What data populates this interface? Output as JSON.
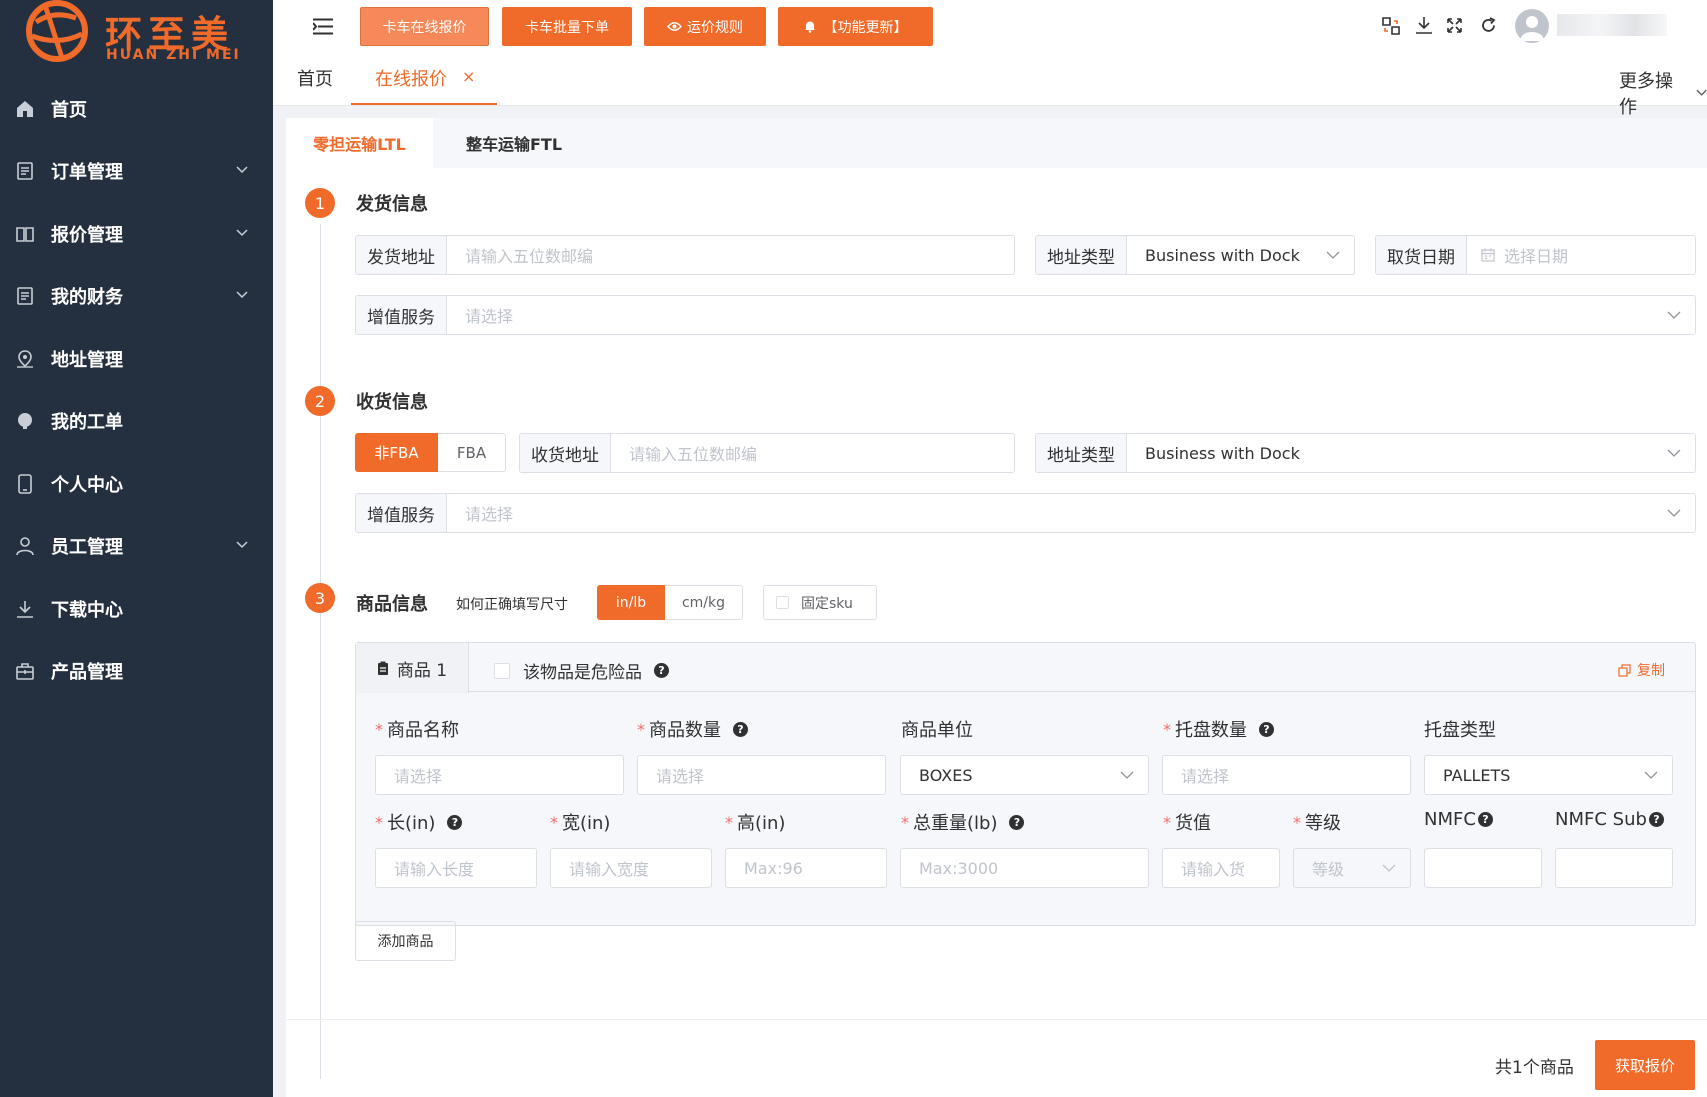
{
  "brand": {
    "name": "环至美",
    "subtitle": "HUAN ZHI MEI",
    "accent": "#f06a2a",
    "sidebar_bg": "#24303f"
  },
  "sidebar": {
    "items": [
      {
        "label": "首页",
        "icon": "home-icon"
      },
      {
        "label": "订单管理",
        "icon": "order-icon"
      },
      {
        "label": "报价管理",
        "icon": "book-icon"
      },
      {
        "label": "我的财务",
        "icon": "finance-icon"
      },
      {
        "label": "地址管理",
        "icon": "location-icon"
      },
      {
        "label": "我的工单",
        "icon": "ticket-icon"
      },
      {
        "label": "个人中心",
        "icon": "tablet-icon"
      },
      {
        "label": "员工管理",
        "icon": "user-icon"
      },
      {
        "label": "下载中心",
        "icon": "download-icon"
      },
      {
        "label": "产品管理",
        "icon": "bag-icon"
      }
    ]
  },
  "toolbar": {
    "btn_online_quote": "卡车在线报价",
    "btn_batch_order": "卡车批量下单",
    "btn_rules": "运价规则",
    "btn_updates": "【功能更新】"
  },
  "page_tabs": {
    "home": "首页",
    "active": "在线报价",
    "more": "更多操作"
  },
  "transport_tabs": {
    "ltl": "零担运输LTL",
    "ftl": "整车运输FTL"
  },
  "shipper": {
    "step": "1",
    "title": "发货信息",
    "address_label": "发货地址",
    "address_placeholder": "请输入五位数邮编",
    "addr_type_label": "地址类型",
    "addr_type_value": "Business with Dock",
    "pickup_label": "取货日期",
    "pickup_placeholder": "选择日期",
    "service_label": "增值服务",
    "service_placeholder": "请选择"
  },
  "consignee": {
    "step": "2",
    "title": "收货信息",
    "toggle_nonfba": "非FBA",
    "toggle_fba": "FBA",
    "address_label": "收货地址",
    "address_placeholder": "请输入五位数邮编",
    "addr_type_label": "地址类型",
    "addr_type_value": "Business with Dock",
    "service_label": "增值服务",
    "service_placeholder": "请选择"
  },
  "goods": {
    "step": "3",
    "title": "商品信息",
    "hint": "如何正确填写尺寸",
    "unit_inlb": "in/lb",
    "unit_cmkg": "cm/kg",
    "fixed_sku": "固定sku",
    "item_tab": "商品 1",
    "hazard_label": "该物品是危险品",
    "copy_label": "复制",
    "fields": {
      "name_label": "商品名称",
      "name_placeholder": "请选择",
      "qty_label": "商品数量",
      "qty_placeholder": "请选择",
      "unit_label": "商品单位",
      "unit_value": "BOXES",
      "pallet_qty_label": "托盘数量",
      "pallet_qty_placeholder": "请选择",
      "pallet_type_label": "托盘类型",
      "pallet_type_value": "PALLETS",
      "length_label": "长(in)",
      "length_placeholder": "请输入长度",
      "width_label": "宽(in)",
      "width_placeholder": "请输入宽度",
      "height_label": "高(in)",
      "height_placeholder": "Max:96",
      "weight_label": "总重量(lb)",
      "weight_placeholder": "Max:3000",
      "value_label": "货值",
      "value_placeholder": "请输入货",
      "class_label": "等级",
      "class_placeholder": "等级",
      "nmfc_label": "NMFC",
      "nmfc_sub_label": "NMFC Sub"
    },
    "add_button": "添加商品"
  },
  "footer": {
    "count_text": "共1个商品",
    "submit": "获取报价"
  }
}
